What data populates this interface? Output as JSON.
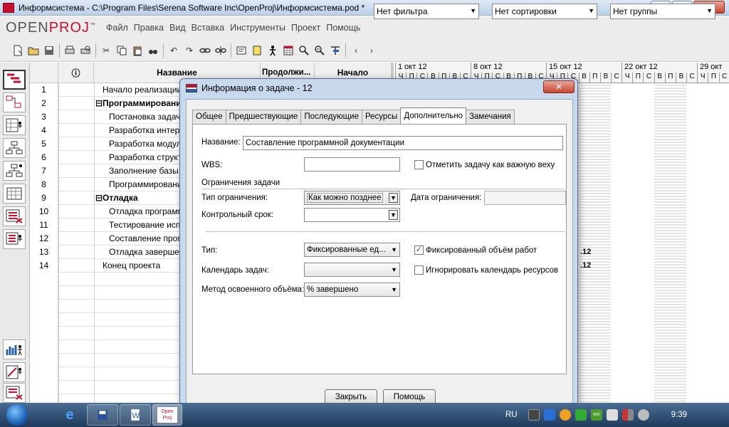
{
  "window": {
    "title": "Информсистема - C:\\Program Files\\Serena Software Inc\\OpenProj\\Информсистема.pod *"
  },
  "app": {
    "logo_a": "OPEN",
    "logo_b": "PROJ",
    "logo_tm": "™"
  },
  "menu": [
    "Файл",
    "Правка",
    "Вид",
    "Вставка",
    "Инструменты",
    "Проект",
    "Помощь"
  ],
  "filters": {
    "filter": "Нет фильтра",
    "sort": "Нет сортировки",
    "group": "Нет группы"
  },
  "grid": {
    "headers": {
      "info": "ⓘ",
      "name": "Название",
      "duration": "Продолжи...",
      "start": "Начало"
    },
    "rows": [
      {
        "n": "1",
        "name": "Начало реализации п",
        "indent": 1,
        "bold": false
      },
      {
        "n": "2",
        "name": "⊟Программирование",
        "indent": 0,
        "bold": true
      },
      {
        "n": "3",
        "name": "Постановка задачи",
        "indent": 2,
        "bold": false
      },
      {
        "n": "4",
        "name": "Разработка интерф",
        "indent": 2,
        "bold": false
      },
      {
        "n": "5",
        "name": "Разработка модуле",
        "indent": 2,
        "bold": false
      },
      {
        "n": "6",
        "name": "Разработка структ",
        "indent": 2,
        "bold": false
      },
      {
        "n": "7",
        "name": "Заполнение базы д",
        "indent": 2,
        "bold": false
      },
      {
        "n": "8",
        "name": "Программирование",
        "indent": 2,
        "bold": false
      },
      {
        "n": "9",
        "name": "⊟Отладка",
        "indent": 0,
        "bold": true
      },
      {
        "n": "10",
        "name": "Отладка программ",
        "indent": 2,
        "bold": false
      },
      {
        "n": "11",
        "name": "Тестирование испр",
        "indent": 2,
        "bold": false
      },
      {
        "n": "12",
        "name": "Составление прогр",
        "indent": 2,
        "bold": false
      },
      {
        "n": "13",
        "name": "Отладка завершен",
        "indent": 2,
        "bold": false
      },
      {
        "n": "14",
        "name": "Конец проекта",
        "indent": 1,
        "bold": false
      }
    ]
  },
  "gantt": {
    "weeks": [
      "1 окт 12",
      "8 окт 12",
      "15 окт 12",
      "22 окт 12",
      "29 окт"
    ],
    "days": [
      "Ч",
      "П",
      "С",
      "В",
      "П",
      "В",
      "С",
      "Ч",
      "П",
      "С",
      "В",
      "П",
      "В",
      "С",
      "Ч",
      "П",
      "С",
      "В",
      "П",
      "В",
      "С",
      "Ч",
      "П",
      "С",
      "В",
      "П",
      "В",
      "С",
      "Ч",
      "П",
      "С",
      "В",
      "П",
      "В",
      "С",
      "Ч",
      "П",
      "С",
      "В",
      "П",
      "В",
      "С"
    ],
    "label13": ".12",
    "label14": ".12"
  },
  "dialog": {
    "title": "Информация о задаче - 12",
    "tabs": [
      "Общее",
      "Предшествующие",
      "Последующие",
      "Ресурсы",
      "Дополнительно",
      "Замечания"
    ],
    "active_tab": 4,
    "name_label": "Название:",
    "name_value": "Составление программной документации",
    "wbs_label": "WBS:",
    "wbs_value": "",
    "milestone_label": "Отметить задачу как важную веху",
    "milestone_checked": "",
    "constraints_group": "Ограничения задачи",
    "constraint_type_label": "Тип ограничения:",
    "constraint_type_value": "Как можно позднее",
    "constraint_date_label": "Дата ограничения:",
    "constraint_date_value": "",
    "deadline_label": "Контрольный срок:",
    "deadline_value": "",
    "type_label": "Тип:",
    "type_value": "Фиксированные ед...",
    "fixed_work_label": "Фиксированный объём работ",
    "fixed_work_checked": "✓",
    "calendar_label": "Календарь задач:",
    "calendar_value": "",
    "ignore_cal_label": "Игнорировать календарь ресурсов",
    "ignore_cal_checked": "",
    "ev_label": "Метод освоенного объёма:",
    "ev_value": "% завершено",
    "close_btn": "Закрыть",
    "help_btn": "Помощь"
  },
  "taskbar": {
    "lang": "RU",
    "time": "9:39",
    "openproj_task": "Open Proj"
  }
}
